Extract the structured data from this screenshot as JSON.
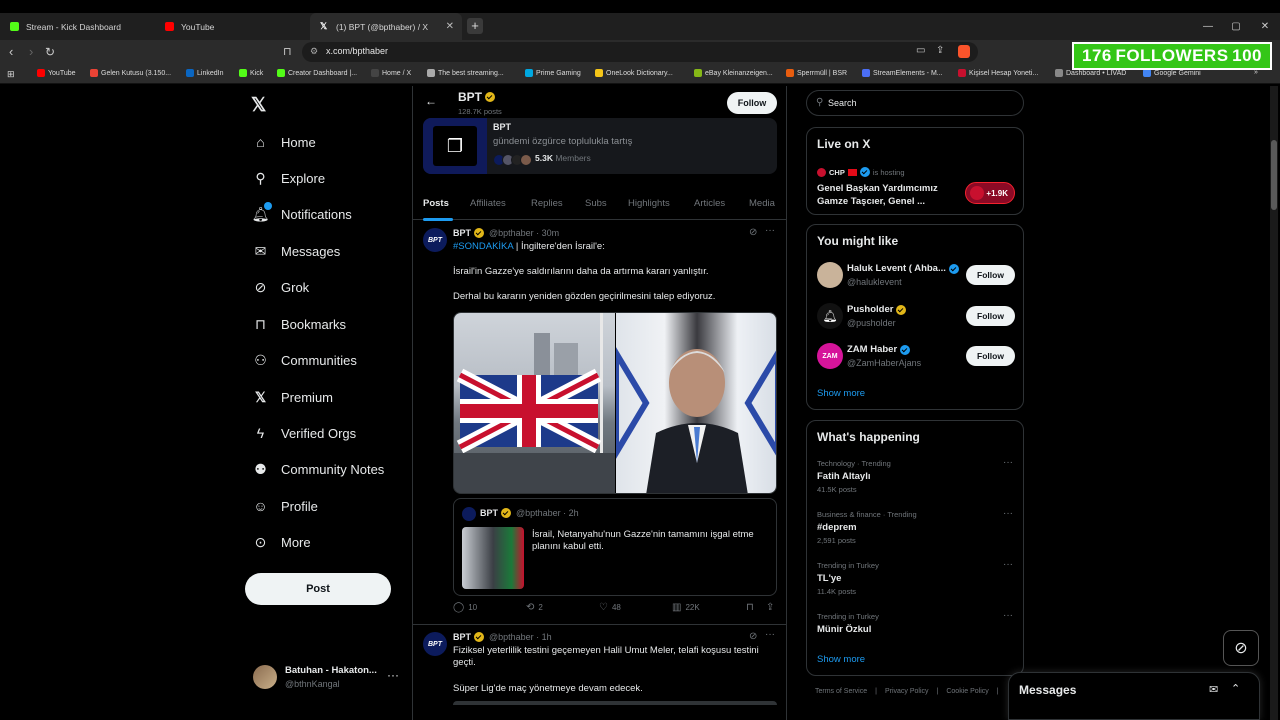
{
  "browser": {
    "tabs": [
      {
        "label": "Stream - Kick Dashboard",
        "color": "#53fc18"
      },
      {
        "label": "YouTube",
        "color": "#ff0000"
      },
      {
        "label": "(1) BPT (@bpthaber) / X",
        "color": "#ffffff"
      }
    ],
    "url": "x.com/bpthaber",
    "bookmarks": [
      "YouTube",
      "Gelen Kutusu (3.150...",
      "LinkedIn",
      "Kick",
      "Creator Dashboard |...",
      "Home / X",
      "The best streaming...",
      "Prime Gaming",
      "OneLook Dictionary...",
      "eBay Kleinanzeigen...",
      "Sperrmüll | BSR",
      "StreamElements - M...",
      "Kişisel Hesap Yoneti...",
      "Dashboard • LIVAD",
      "Google Gemini"
    ]
  },
  "overlay": {
    "left": "176",
    "middle": "FOLLOWERS",
    "right": "100"
  },
  "nav": {
    "items": [
      "Home",
      "Explore",
      "Notifications",
      "Messages",
      "Grok",
      "Bookmarks",
      "Communities",
      "Premium",
      "Verified Orgs",
      "Community Notes",
      "Profile",
      "More"
    ],
    "post": "Post",
    "account_name": "Batuhan - Hakaton...",
    "account_handle": "@bthnKangal"
  },
  "profile": {
    "name": "BPT",
    "posts": "128.7K posts",
    "follow": "Follow",
    "community_name": "BPT",
    "community_desc": "gündemi özgürce toplulukla tartış",
    "members_count": "5.3K",
    "members_label": "Members"
  },
  "tabs": [
    "Posts",
    "Affiliates",
    "Replies",
    "Subs",
    "Highlights",
    "Articles",
    "Media"
  ],
  "tweet1": {
    "name": "BPT",
    "meta": "@bpthaber · 30m",
    "hashtag": "#SONDAKİKA",
    "line1_rest": " | İngiltere'den İsrail'e:",
    "line2": "İsrail'in Gazze'ye saldırılarını daha da artırma kararı yanlıştır.",
    "line3": "Derhal bu kararın yeniden gözden geçirilmesini talep ediyoruz.",
    "quote_name": "BPT",
    "quote_meta": "@bpthaber · 2h",
    "quote_text": "İsrail, Netanyahu'nun Gazze'nin tamamını işgal etme planını kabul etti.",
    "replies": "10",
    "reposts": "2",
    "likes": "48",
    "views": "22K"
  },
  "tweet2": {
    "name": "BPT",
    "meta": "@bpthaber · 1h",
    "line1": "Fiziksel yeterlilik testini geçemeyen Halil Umut Meler, telafi koşusu testini geçti.",
    "line2": "Süper Lig'de maç yönetmeye devam edecek."
  },
  "search": {
    "placeholder": "Search"
  },
  "live": {
    "title": "Live on X",
    "host": "CHP",
    "hosting": "is hosting",
    "stream_title": "Genel Başkan Yardımcımız Gamze Taşcıer, Genel ...",
    "count": "+1.9K"
  },
  "suggest": {
    "title": "You might like",
    "users": [
      {
        "name": "Haluk Levent ( Ahba...",
        "handle": "@haluklevent",
        "badge": "blue",
        "color": "#c9b39a"
      },
      {
        "name": "Pusholder",
        "handle": "@pusholder",
        "badge": "gold",
        "color": "#111111"
      },
      {
        "name": "ZAM Haber",
        "handle": "@ZamHaberAjans",
        "badge": "blue",
        "color": "#d6149a"
      }
    ],
    "follow": "Follow",
    "show_more": "Show more"
  },
  "trends": {
    "title": "What's happening",
    "items": [
      {
        "context": "Technology · Trending",
        "name": "Fatih Altaylı",
        "count": "41.5K posts"
      },
      {
        "context": "Business & finance · Trending",
        "name": "#deprem",
        "count": "2,591 posts"
      },
      {
        "context": "Trending in Turkey",
        "name": "TL'ye",
        "count": "11.4K posts"
      },
      {
        "context": "Trending in Turkey",
        "name": "Münir Özkul",
        "count": ""
      }
    ],
    "show_more": "Show more"
  },
  "footer": [
    "Terms of Service",
    "|",
    "Privacy Policy",
    "|",
    "Cookie Policy",
    "|"
  ],
  "messages": {
    "title": "Messages"
  }
}
